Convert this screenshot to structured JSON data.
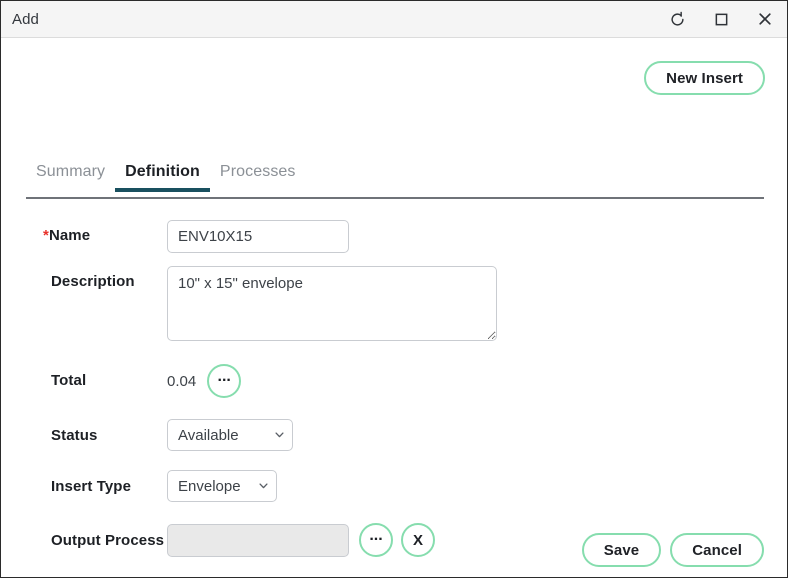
{
  "window": {
    "title": "Add",
    "controls": [
      {
        "name": "refresh-icon",
        "label": "Refresh"
      },
      {
        "name": "maximize-icon",
        "label": "Maximize"
      },
      {
        "name": "close-icon",
        "label": "Close"
      }
    ]
  },
  "toolbar": {
    "new_insert_label": "New Insert"
  },
  "tabs": [
    {
      "label": "Summary",
      "active": false
    },
    {
      "label": "Definition",
      "active": true
    },
    {
      "label": "Processes",
      "active": false
    }
  ],
  "form": {
    "name": {
      "label": "Name",
      "required_marker": "*",
      "value": "ENV10X15",
      "placeholder": ""
    },
    "description": {
      "label": "Description",
      "value": "10\" x 15\" envelope",
      "placeholder": ""
    },
    "total": {
      "label": "Total",
      "value": "0.04",
      "browse_label": "..."
    },
    "status": {
      "label": "Status",
      "value": "Available",
      "options": [
        "Available"
      ]
    },
    "insert_type": {
      "label": "Insert Type",
      "value": "Envelope",
      "options": [
        "Envelope"
      ]
    },
    "output_process": {
      "label": "Output Process",
      "value": "",
      "placeholder": "",
      "browse_label": "...",
      "clear_label": "X"
    }
  },
  "footer": {
    "save_label": "Save",
    "cancel_label": "Cancel"
  },
  "colors": {
    "accent_green": "#86ddae",
    "active_tab_underline": "#19505f",
    "required_star": "#e8312a",
    "titlebar_bg": "#f5f5f5",
    "disabled_field_bg": "#e9e9e9"
  }
}
